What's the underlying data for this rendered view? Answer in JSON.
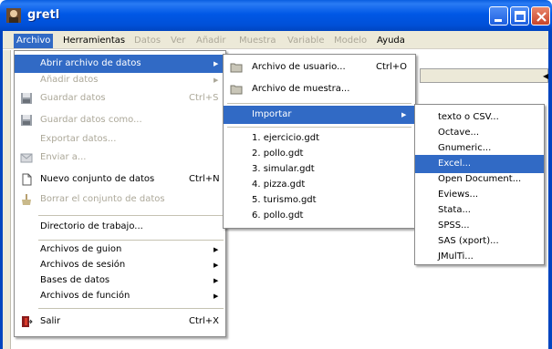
{
  "window": {
    "title": "gretl"
  },
  "menubar": [
    {
      "label": "Archivo",
      "state": "active"
    },
    {
      "label": "Herramientas",
      "state": "normal"
    },
    {
      "label": "Datos",
      "state": "disabled"
    },
    {
      "label": "Ver",
      "state": "disabled"
    },
    {
      "label": "Añadir",
      "state": "disabled"
    },
    {
      "label": "Muestra",
      "state": "disabled"
    },
    {
      "label": "Variable",
      "state": "disabled"
    },
    {
      "label": "Modelo",
      "state": "disabled"
    },
    {
      "label": "Ayuda",
      "state": "normal"
    }
  ],
  "archivo_menu": {
    "items": [
      {
        "label": "Abrir archivo de datos",
        "submenu": true,
        "highlighted": true
      },
      {
        "label": "Añadir datos",
        "submenu": true,
        "disabled": true
      },
      {
        "label": "Guardar datos",
        "accel": "Ctrl+S",
        "disabled": true,
        "icon": "save-icon"
      },
      {
        "label": "Guardar datos como...",
        "disabled": true,
        "icon": "save-as-icon"
      },
      {
        "label": "Exportar datos...",
        "disabled": true
      },
      {
        "label": "Enviar a...",
        "disabled": true,
        "icon": "mail-icon"
      },
      {
        "label": "Nuevo conjunto de datos",
        "accel": "Ctrl+N",
        "icon": "new-document-icon"
      },
      {
        "label": "Borrar el conjunto de datos",
        "disabled": true,
        "icon": "clear-icon"
      },
      {
        "label": "Directorio de trabajo..."
      },
      {
        "label": "Archivos de guion",
        "submenu": true
      },
      {
        "label": "Archivos de sesión",
        "submenu": true
      },
      {
        "label": "Bases de datos",
        "submenu": true
      },
      {
        "label": "Archivos de función",
        "submenu": true
      },
      {
        "label": "Salir",
        "accel": "Ctrl+X",
        "icon": "exit-icon"
      }
    ]
  },
  "abrir_menu": {
    "items": [
      {
        "label": "Archivo de usuario...",
        "accel": "Ctrl+O",
        "icon": "folder-icon"
      },
      {
        "label": "Archivo de muestra...",
        "icon": "folder-icon"
      },
      {
        "label": "Importar",
        "submenu": true,
        "highlighted": true
      },
      {
        "label": "1. ejercicio.gdt"
      },
      {
        "label": "2. pollo.gdt"
      },
      {
        "label": "3. simular.gdt"
      },
      {
        "label": "4. pizza.gdt"
      },
      {
        "label": "5. turismo.gdt"
      },
      {
        "label": "6. pollo.gdt"
      }
    ]
  },
  "importar_menu": {
    "items": [
      {
        "label": "texto o CSV..."
      },
      {
        "label": "Octave..."
      },
      {
        "label": "Gnumeric..."
      },
      {
        "label": "Excel...",
        "highlighted": true
      },
      {
        "label": "Open Document..."
      },
      {
        "label": "Eviews..."
      },
      {
        "label": "Stata..."
      },
      {
        "label": "SPSS..."
      },
      {
        "label": "SAS (xport)..."
      },
      {
        "label": "JMulTi..."
      }
    ]
  },
  "colors": {
    "highlight": "#316ac5",
    "titlebar": "#0058e6",
    "menu_bg": "#ece9d8",
    "disabled": "#aca899"
  }
}
